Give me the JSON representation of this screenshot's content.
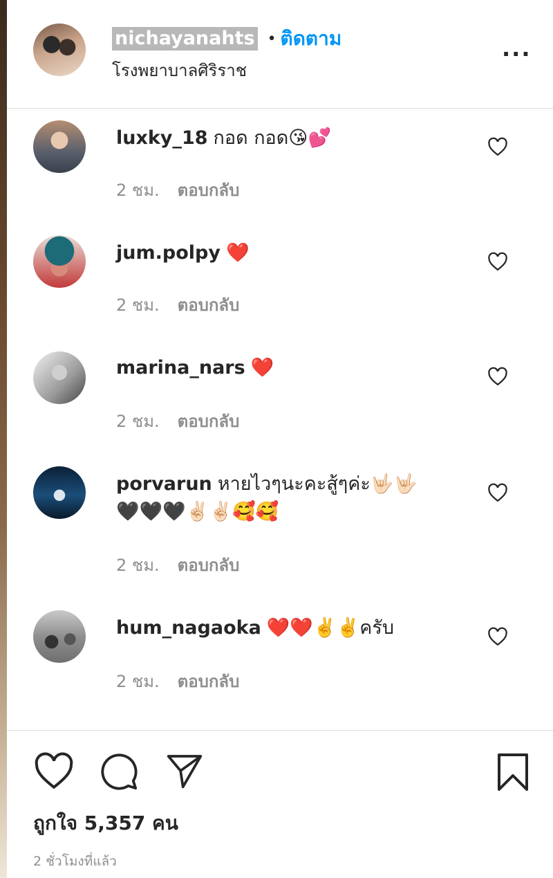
{
  "header": {
    "username": "nichayanahts",
    "separator": "•",
    "follow_label": "ติดตาม",
    "location": "โรงพยาบาลศิริราช",
    "more_label": "..."
  },
  "comments": [
    {
      "username": "luxky_18",
      "text": "กอด กอด😘💕",
      "time": "2 ชม.",
      "reply_label": "ตอบกลับ"
    },
    {
      "username": "jum.polpy",
      "text": "❤️",
      "time": "2 ชม.",
      "reply_label": "ตอบกลับ"
    },
    {
      "username": "marina_nars",
      "text": "❤️",
      "time": "2 ชม.",
      "reply_label": "ตอบกลับ"
    },
    {
      "username": "porvarun",
      "text": "หายไวๆนะคะสู้ๆค่ะ🤟🏻🤟🏻",
      "text2": "🖤🖤🖤✌🏻✌🏻🥰🥰",
      "time": "2 ชม.",
      "reply_label": "ตอบกลับ"
    },
    {
      "username": "hum_nagaoka",
      "text": "❤️❤️✌️✌️ครับ",
      "time": "2 ชม.",
      "reply_label": "ตอบกลับ"
    }
  ],
  "footer": {
    "likes": "ถูกใจ 5,357 คน",
    "posted_time": "2 ชั่วโมงที่แล้ว"
  },
  "colors": {
    "link_blue": "#0095f6",
    "text": "#262626",
    "muted": "#8e8e8e",
    "divider": "#dbdbdb"
  }
}
